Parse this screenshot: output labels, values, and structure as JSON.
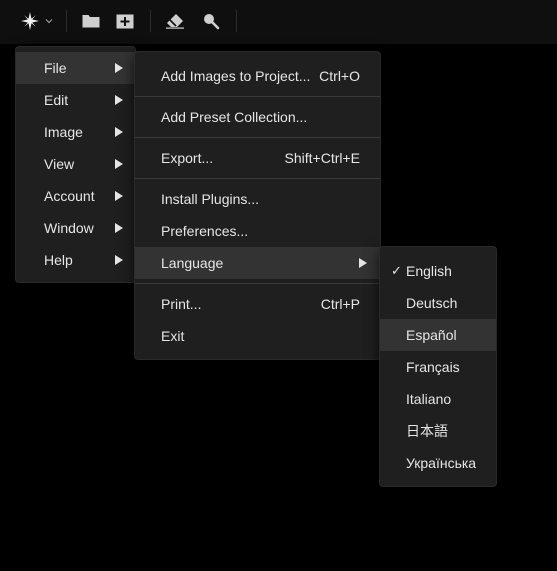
{
  "toolbar": {
    "logo_icon": "sparkle-icon",
    "icons": [
      "folder-icon",
      "add-image-icon",
      "eraser-icon",
      "magnifier-icon"
    ]
  },
  "main_menu": {
    "items": [
      {
        "label": "File"
      },
      {
        "label": "Edit"
      },
      {
        "label": "Image"
      },
      {
        "label": "View"
      },
      {
        "label": "Account"
      },
      {
        "label": "Window"
      },
      {
        "label": "Help"
      }
    ]
  },
  "file_menu": {
    "items": [
      {
        "label": "Add Images to Project...",
        "shortcut": "Ctrl+O"
      },
      {
        "label": "Add Preset Collection..."
      },
      {
        "label": "Export...",
        "shortcut": "Shift+Ctrl+E"
      },
      {
        "label": "Install Plugins..."
      },
      {
        "label": "Preferences..."
      },
      {
        "label": "Language"
      },
      {
        "label": "Print...",
        "shortcut": "Ctrl+P"
      },
      {
        "label": "Exit"
      }
    ]
  },
  "language_menu": {
    "checkmark": "✓",
    "items": [
      {
        "label": "English"
      },
      {
        "label": "Deutsch"
      },
      {
        "label": "Español"
      },
      {
        "label": "Français"
      },
      {
        "label": "Italiano"
      },
      {
        "label": "日本語"
      },
      {
        "label": "Українська"
      }
    ]
  },
  "colors": {
    "menu_bg": "#1f1f1f",
    "highlight": "#333333",
    "text": "#e6e6e6"
  }
}
